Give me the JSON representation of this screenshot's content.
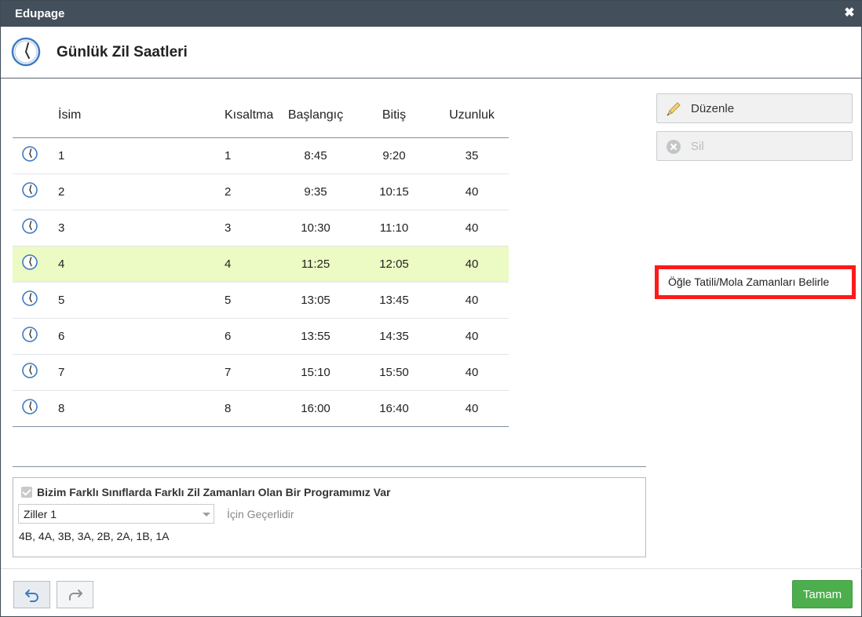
{
  "window": {
    "title": "Edupage",
    "close_glyph": "✖"
  },
  "header": {
    "title": "Günlük Zil Saatleri",
    "icon": "clock-icon"
  },
  "table": {
    "columns": {
      "name": "İsim",
      "short": "Kısaltma",
      "start": "Başlangıç",
      "end": "Bitiş",
      "length": "Uzunluk"
    },
    "rows": [
      {
        "name": "1",
        "short": "1",
        "start": "8:45",
        "end": "9:20",
        "length": "35"
      },
      {
        "name": "2",
        "short": "2",
        "start": "9:35",
        "end": "10:15",
        "length": "40"
      },
      {
        "name": "3",
        "short": "3",
        "start": "10:30",
        "end": "11:10",
        "length": "40"
      },
      {
        "name": "4",
        "short": "4",
        "start": "11:25",
        "end": "12:05",
        "length": "40",
        "selected": true
      },
      {
        "name": "5",
        "short": "5",
        "start": "13:05",
        "end": "13:45",
        "length": "40"
      },
      {
        "name": "6",
        "short": "6",
        "start": "13:55",
        "end": "14:35",
        "length": "40"
      },
      {
        "name": "7",
        "short": "7",
        "start": "15:10",
        "end": "15:50",
        "length": "40"
      },
      {
        "name": "8",
        "short": "8",
        "start": "16:00",
        "end": "16:40",
        "length": "40"
      }
    ]
  },
  "sidebar": {
    "edit_label": "Düzenle",
    "delete_label": "Sil",
    "lunch_label": "Öğle Tatili/Mola Zamanları Belirle"
  },
  "group": {
    "checkbox_label": "Bizim Farklı Sınıflarda Farklı Zil Zamanları Olan Bir Programımız Var",
    "checked": true,
    "select_value": "Ziller 1",
    "valid_for": "İçin Geçerlidir",
    "classes": "4B, 4A, 3B, 3A, 2B, 2A, 1B, 1A"
  },
  "footer": {
    "ok_label": "Tamam"
  },
  "colors": {
    "accent_green": "#4cae4c",
    "selected_row": "#ecfac3",
    "titlebar": "#434f5b",
    "highlight_red": "#ff1a1a"
  }
}
